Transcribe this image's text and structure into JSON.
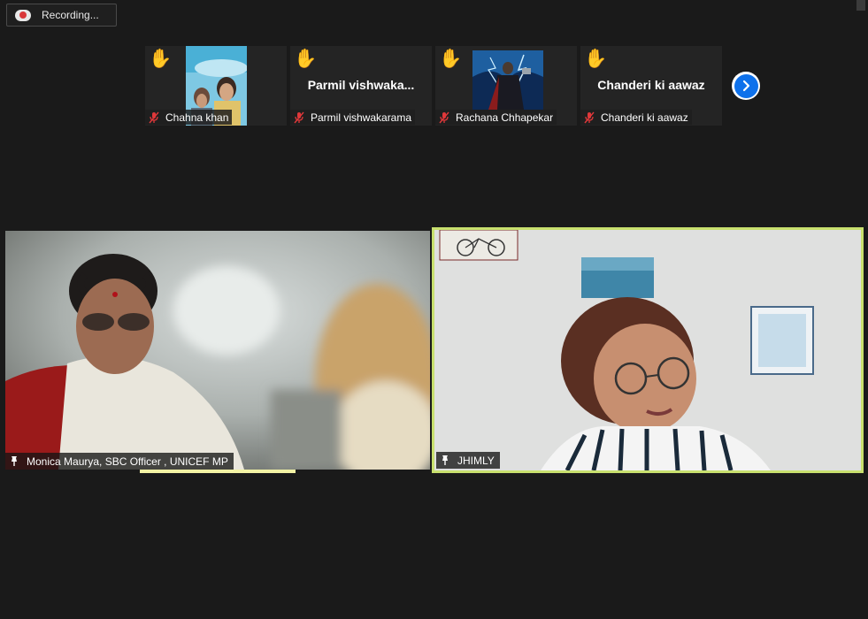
{
  "recording": {
    "label": "Recording..."
  },
  "thumbnails": [
    {
      "name": "Chahna khan",
      "display": "",
      "has_photo": true,
      "hand_raised": true,
      "muted": true
    },
    {
      "name": "Parmil vishwakarama",
      "display": "Parmil  vishwaka...",
      "has_photo": false,
      "hand_raised": true,
      "muted": true
    },
    {
      "name": "Rachana Chhapekar",
      "display": "",
      "has_photo": true,
      "hand_raised": true,
      "muted": true
    },
    {
      "name": "Chanderi ki aawaz",
      "display": "Chanderi ki aawaz",
      "has_photo": false,
      "hand_raised": true,
      "muted": true
    }
  ],
  "next_page_icon": "chevron-right-icon",
  "videos": {
    "left": {
      "name": "Monica Maurya, SBC Officer , UNICEF MP",
      "pinned": true
    },
    "right": {
      "name": "JHIMLY",
      "pinned": true,
      "active_speaker": true
    }
  },
  "colors": {
    "background": "#1a1a1a",
    "active_speaker_border": "#c8e06e",
    "mute_red": "#e0383a",
    "next_button": "#0e71eb"
  }
}
